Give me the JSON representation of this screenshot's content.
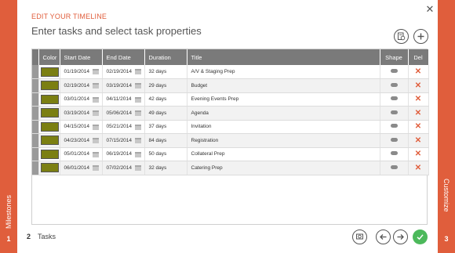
{
  "sidebar_left": {
    "label": "Milestones",
    "number": "1"
  },
  "sidebar_right": {
    "label": "Customize",
    "number": "3"
  },
  "header": {
    "eyebrow": "EDIT YOUR TIMELINE",
    "title": "Enter tasks and select task properties"
  },
  "icons": {
    "close": "close-icon",
    "calendar_doc": "calendar-document-icon",
    "add": "plus-icon",
    "preview": "preview-icon",
    "back": "arrow-left-icon",
    "next": "arrow-right-icon",
    "confirm": "checkmark-icon"
  },
  "colors": {
    "accent": "#e05e3c",
    "swatch": "#7b7f12",
    "confirm": "#4cb95b"
  },
  "table": {
    "headers": {
      "color": "Color",
      "start": "Start Date",
      "end": "End Date",
      "duration": "Duration",
      "title": "Title",
      "shape": "Shape",
      "del": "Del"
    },
    "rows": [
      {
        "start": "01/19/2014",
        "end": "02/19/2014",
        "duration": "32 days",
        "title": "A/V & Staging Prep"
      },
      {
        "start": "02/19/2014",
        "end": "03/19/2014",
        "duration": "29 days",
        "title": "Budget"
      },
      {
        "start": "03/01/2014",
        "end": "04/11/2014",
        "duration": "42 days",
        "title": "Evening Events Prep"
      },
      {
        "start": "03/19/2014",
        "end": "05/06/2014",
        "duration": "49 days",
        "title": "Agenda"
      },
      {
        "start": "04/15/2014",
        "end": "05/21/2014",
        "duration": "37 days",
        "title": "Invitation"
      },
      {
        "start": "04/23/2014",
        "end": "07/15/2014",
        "duration": "84 days",
        "title": "Registration"
      },
      {
        "start": "05/01/2014",
        "end": "06/19/2014",
        "duration": "50 days",
        "title": "Collateral Prep"
      },
      {
        "start": "06/01/2014",
        "end": "07/02/2014",
        "duration": "32 days",
        "title": "Catering Prep"
      }
    ],
    "del_symbol": "✕"
  },
  "footer": {
    "step_number": "2",
    "step_label": "Tasks"
  }
}
